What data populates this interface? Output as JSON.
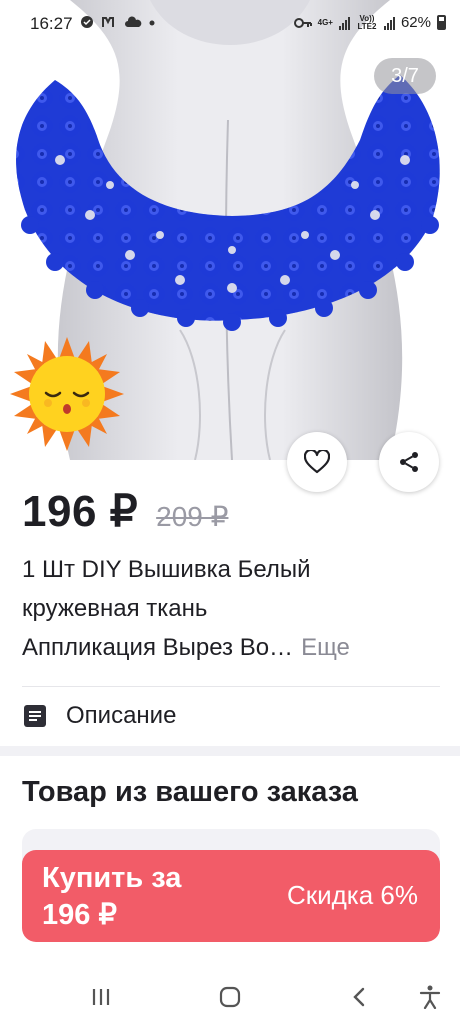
{
  "status_bar": {
    "time": "16:27",
    "network_label": "4G+",
    "volte_label": "Vo)) LTE2",
    "battery_percent": "62%",
    "battery_level": 0.62
  },
  "gallery": {
    "counter": "3/7",
    "image_description_icon": "blue-lace-collar-photo",
    "badge_icon": "sleeping-sun-icon"
  },
  "product": {
    "price": "196 ₽",
    "old_price": "209 ₽",
    "title_lines": [
      "1 Шт DIY Вышивка Белый",
      "кружевная ткань",
      "Аппликация Вырез Во…"
    ],
    "more_label": "Еще"
  },
  "description": {
    "label": "Описание",
    "icon": "document-icon"
  },
  "order_section": {
    "title": "Товар из вашего заказа"
  },
  "buy_bar": {
    "label_line1": "Купить за",
    "label_line2": "196 ₽",
    "discount": "Скидка 6%"
  },
  "nav": {
    "items": [
      "recent-apps-icon",
      "home-icon",
      "back-icon",
      "accessibility-icon"
    ]
  },
  "colors": {
    "accent": "#f25c68",
    "lace_blue": "#1f3bd6",
    "text": "#1f1f24",
    "muted": "#9a9aa4"
  }
}
